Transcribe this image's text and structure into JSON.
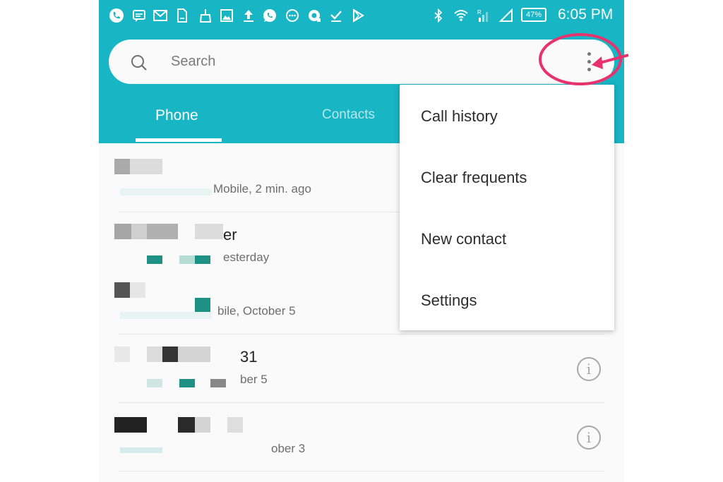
{
  "status_bar": {
    "time": "6:05 PM",
    "battery": "47%",
    "icons": [
      "phone-icon",
      "message-icon",
      "gmail-icon",
      "file-icon",
      "broom-icon",
      "image-icon",
      "upload-icon",
      "whatsapp-icon",
      "dots-circle-icon",
      "camera-icon",
      "check-icon",
      "play-store-icon",
      "bluetooth-icon",
      "wifi-icon",
      "signal-r-icon",
      "signal-icon"
    ]
  },
  "search": {
    "placeholder": "Search"
  },
  "tabs": [
    {
      "label": "Phone",
      "active": true
    },
    {
      "label": "Contacts",
      "active": false
    }
  ],
  "call_log": [
    {
      "name_partial": "",
      "sub_partial": "Mobile, 2 min. ago"
    },
    {
      "name_partial": "er",
      "sub_partial": "esterday"
    },
    {
      "name_partial": "",
      "sub_partial": "bile, October 5"
    },
    {
      "name_partial": "31",
      "sub_partial": "ber 5"
    },
    {
      "name_partial": "",
      "sub_partial": "ober 3"
    }
  ],
  "overflow_menu": {
    "items": [
      "Call history",
      "Clear frequents",
      "New contact",
      "Settings"
    ]
  },
  "colors": {
    "accent": "#18b5c4",
    "annotation": "#e8326e"
  }
}
